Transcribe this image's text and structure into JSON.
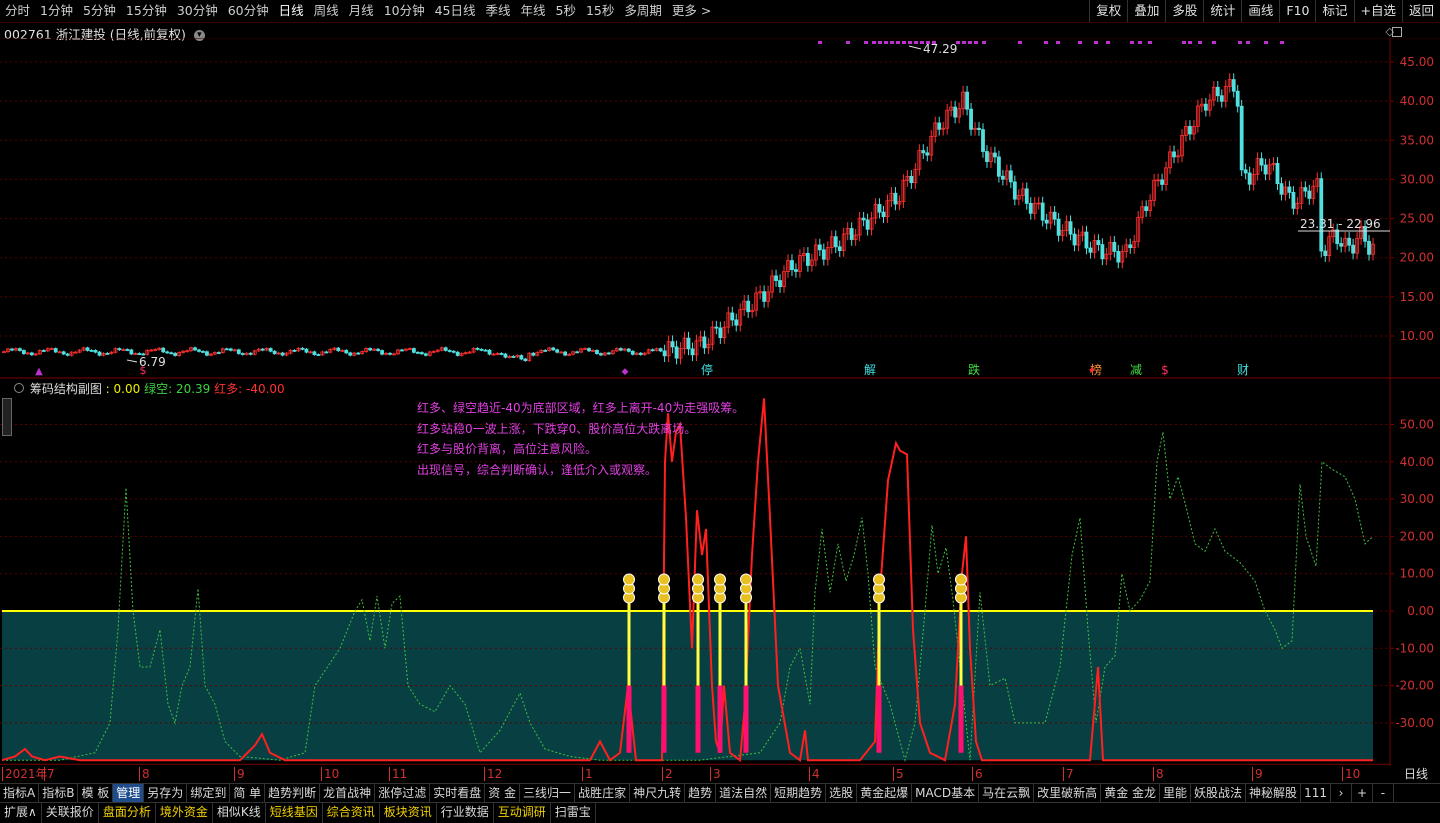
{
  "toolbar": {
    "periods": [
      "分时",
      "1分钟",
      "5分钟",
      "15分钟",
      "30分钟",
      "60分钟",
      "日线",
      "周线",
      "月线",
      "10分钟",
      "45日线",
      "季线",
      "年线",
      "5秒",
      "15秒",
      "多周期",
      "更多 >"
    ],
    "active_period": "日线",
    "right_buttons": [
      "复权",
      "叠加",
      "多股",
      "统计",
      "画线",
      "F10",
      "标记",
      "+自选",
      "返回"
    ]
  },
  "stock": {
    "code": "002761",
    "name": "浙江建投",
    "mode": "(日线,前复权)",
    "dropdown_icon": "chevron-down-icon"
  },
  "main_chart": {
    "high_label": "47.29",
    "low_label": "6.79",
    "price_label": "23.31 - 22.96",
    "y_ticks": [
      "45.00",
      "40.00",
      "35.00",
      "30.00",
      "25.00",
      "20.00",
      "15.00",
      "10.00"
    ],
    "markers": [
      "停",
      "解",
      "跌",
      "榜",
      "减",
      "$",
      "财"
    ],
    "colors": {
      "up": "#ff3030",
      "down": "#50e0e0",
      "marker_purple": "#c030d0"
    }
  },
  "indicator": {
    "name": "筹码结构副图",
    "value0_label": ": 0.00",
    "green_label": "绿空: 20.39",
    "red_label": "红多: -40.00",
    "y_ticks": [
      "50.00",
      "40.00",
      "30.00",
      "20.00",
      "10.00",
      "0.00",
      "-10.00",
      "-20.00",
      "-30.00"
    ],
    "notes": [
      "红多、绿空趋近-40为底部区域，红多上离开-40为走强吸筹。",
      "红多站稳0一波上涨，下跌穿0、股价高位大跌离场。",
      "红多与股价背离，高位注意风险。",
      "出现信号，综合判断确认，逢低介入或观察。"
    ],
    "colors": {
      "red": "#ff2020",
      "green": "#40c040",
      "zero": "#ffff00",
      "fill": "#073f42",
      "bar": "#ff1070"
    }
  },
  "date_axis": {
    "labels": [
      "2021年",
      "7",
      "8",
      "9",
      "10",
      "11",
      "12",
      "1",
      "2",
      "3",
      "4",
      "5",
      "6",
      "7",
      "8",
      "9",
      "10"
    ],
    "period_label": "日线"
  },
  "bottom_tabs": {
    "row1": [
      "指标A",
      "指标B",
      "模 板",
      "管理",
      "另存为",
      "绑定到",
      "简 单",
      "趋势判断",
      "龙首战神",
      "涨停过滤",
      "实时看盘",
      "资 金",
      "三线归一",
      "战胜庄家",
      "神尺九转",
      "趋势",
      "道法自然",
      "短期趋势",
      "选股",
      "黄金起爆",
      "MACD基本",
      "马在云飘",
      "改里破新高",
      "黄金 金龙",
      "里能",
      "妖股战法",
      "神秘解股",
      "111"
    ],
    "row1_selected": "管理",
    "row1_extra": [
      "›",
      "+",
      "-"
    ],
    "row2": [
      "扩展∧",
      "关联报价",
      "盘面分析",
      "境外资金",
      "相似K线",
      "短线基因",
      "综合资讯",
      "板块资讯",
      "行业数据",
      "互动调研",
      "扫雷宝"
    ],
    "row2_yellow": [
      "盘面分析",
      "境外资金",
      "短线基因",
      "综合资讯",
      "板块资讯",
      "互动调研"
    ]
  }
}
